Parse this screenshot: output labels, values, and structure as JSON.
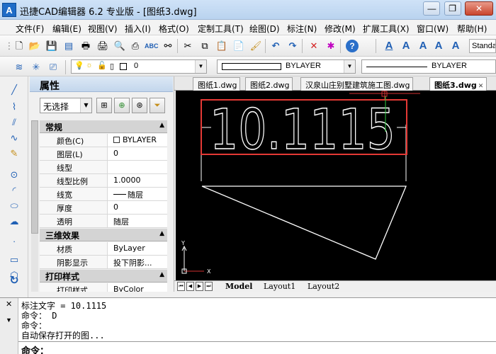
{
  "window": {
    "title": "迅捷CAD编辑器 6.2 专业版 - [图纸3.dwg]",
    "app_icon_letter": "A"
  },
  "menu": [
    "文件(F)",
    "编辑(E)",
    "视图(V)",
    "插入(I)",
    "格式(O)",
    "定制工具(T)",
    "绘图(D)",
    "标注(N)",
    "修改(M)",
    "扩展工具(X)",
    "窗口(W)",
    "帮助(H)"
  ],
  "toolbar": {
    "text_style": "Standard"
  },
  "props_bar": {
    "layer_value": "0",
    "color_value": "BYLAYER",
    "linetype_value": "BYLAYER"
  },
  "properties": {
    "title": "属性",
    "selection": "无选择",
    "sections": [
      {
        "name": "常规",
        "rows": [
          {
            "label": "颜色(C)",
            "value": "BYLAYER"
          },
          {
            "label": "图层(L)",
            "value": "0"
          },
          {
            "label": "线型",
            "value": ""
          },
          {
            "label": "线型比例",
            "value": "1.0000"
          },
          {
            "label": "线宽",
            "value": "随层"
          },
          {
            "label": "厚度",
            "value": "0"
          },
          {
            "label": "透明",
            "value": "随层"
          }
        ]
      },
      {
        "name": "三维效果",
        "rows": [
          {
            "label": "材质",
            "value": "ByLayer"
          },
          {
            "label": "阴影显示",
            "value": "投下阴影..."
          }
        ]
      },
      {
        "name": "打印样式",
        "rows": [
          {
            "label": "打印样式",
            "value": "ByColor"
          }
        ]
      }
    ]
  },
  "tabs": [
    "图纸1.dwg",
    "图纸2.dwg",
    "汉泉山庄别墅建筑施工图.dwg",
    "图纸3.dwg"
  ],
  "active_tab": "图纸3.dwg",
  "drawing": {
    "dimension_text": "10.1115",
    "highlight_color": "#e53935"
  },
  "layout_tabs": [
    "Model",
    "Layout1",
    "Layout2"
  ],
  "command_history": [
    "标注文字 = 10.1115",
    "命令： D",
    "命令：",
    "自动保存打开的图...",
    "命令："
  ],
  "command_prompt": "命令："
}
